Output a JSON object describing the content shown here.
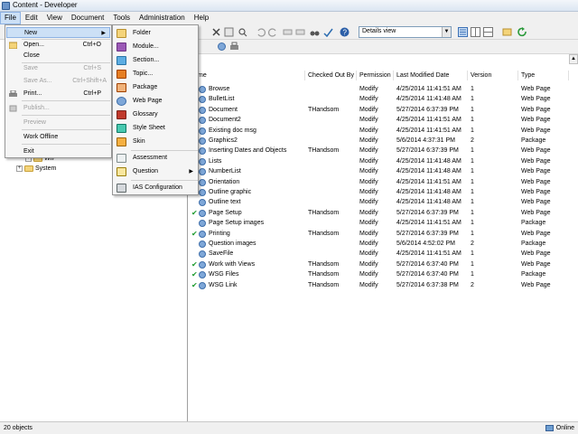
{
  "window": {
    "title": "Content - Developer"
  },
  "menubar": [
    "File",
    "Edit",
    "View",
    "Document",
    "Tools",
    "Administration",
    "Help"
  ],
  "view_select": {
    "value": "Details view"
  },
  "file_menu": {
    "new": "New",
    "open": "Open...",
    "open_shortcut": "Ctrl+O",
    "close": "Close",
    "save": "Save",
    "save_shortcut": "Ctrl+S",
    "save_as": "Save As...",
    "save_as_shortcut": "Ctrl+Shift+A",
    "print": "Print...",
    "print_shortcut": "Ctrl+P",
    "publish": "Publish...",
    "preview": "Preview",
    "work_offline": "Work Offline",
    "exit": "Exit"
  },
  "new_submenu": [
    "Folder",
    "Module...",
    "Section...",
    "Topic...",
    "Package",
    "Web Page",
    "Glossary",
    "Style Sheet",
    "Skin",
    "Assessment",
    "Question",
    "IAS Configuration"
  ],
  "tree": {
    "wip": "WIP",
    "system": "System"
  },
  "columns": {
    "name": "me",
    "checked_out_by": "Checked Out By",
    "permission": "Permission",
    "last_modified": "Last Modified Date",
    "version": "Version",
    "type": "Type"
  },
  "rows": [
    {
      "name": "Browse",
      "checked": "",
      "perm": "Modify",
      "date": "4/25/2014 11:41:51 AM",
      "ver": "1",
      "type": "Web Page",
      "check": false
    },
    {
      "name": "BulletList",
      "checked": "",
      "perm": "Modify",
      "date": "4/25/2014 11:41:48 AM",
      "ver": "1",
      "type": "Web Page",
      "check": false
    },
    {
      "name": "Document",
      "checked": "THandsom",
      "perm": "Modify",
      "date": "5/27/2014 6:37:39 PM",
      "ver": "1",
      "type": "Web Page",
      "check": false
    },
    {
      "name": "Document2",
      "checked": "",
      "perm": "Modify",
      "date": "4/25/2014 11:41:51 AM",
      "ver": "1",
      "type": "Web Page",
      "check": false
    },
    {
      "name": "Existing doc msg",
      "checked": "",
      "perm": "Modify",
      "date": "4/25/2014 11:41:51 AM",
      "ver": "1",
      "type": "Web Page",
      "check": false
    },
    {
      "name": "Graphics2",
      "checked": "",
      "perm": "Modify",
      "date": "5/6/2014 4:37:31 PM",
      "ver": "2",
      "type": "Package",
      "check": false
    },
    {
      "name": "Inserting Dates and Objects",
      "checked": "THandsom",
      "perm": "Modify",
      "date": "5/27/2014 6:37:39 PM",
      "ver": "1",
      "type": "Web Page",
      "check": false
    },
    {
      "name": "Lists",
      "checked": "",
      "perm": "Modify",
      "date": "4/25/2014 11:41:48 AM",
      "ver": "1",
      "type": "Web Page",
      "check": false
    },
    {
      "name": "NumberList",
      "checked": "",
      "perm": "Modify",
      "date": "4/25/2014 11:41:48 AM",
      "ver": "1",
      "type": "Web Page",
      "check": false
    },
    {
      "name": "Orientation",
      "checked": "",
      "perm": "Modify",
      "date": "4/25/2014 11:41:51 AM",
      "ver": "1",
      "type": "Web Page",
      "check": false
    },
    {
      "name": "Outline graphic",
      "checked": "",
      "perm": "Modify",
      "date": "4/25/2014 11:41:48 AM",
      "ver": "1",
      "type": "Web Page",
      "check": false
    },
    {
      "name": "Outline text",
      "checked": "",
      "perm": "Modify",
      "date": "4/25/2014 11:41:48 AM",
      "ver": "1",
      "type": "Web Page",
      "check": false
    },
    {
      "name": "Page Setup",
      "checked": "THandsom",
      "perm": "Modify",
      "date": "5/27/2014 6:37:39 PM",
      "ver": "1",
      "type": "Web Page",
      "check": true
    },
    {
      "name": "Page Setup images",
      "checked": "",
      "perm": "Modify",
      "date": "4/25/2014 11:41:51 AM",
      "ver": "1",
      "type": "Package",
      "check": false
    },
    {
      "name": "Printing",
      "checked": "THandsom",
      "perm": "Modify",
      "date": "5/27/2014 6:37:39 PM",
      "ver": "1",
      "type": "Web Page",
      "check": true
    },
    {
      "name": "Question images",
      "checked": "",
      "perm": "Modify",
      "date": "5/6/2014 4:52:02 PM",
      "ver": "2",
      "type": "Package",
      "check": false
    },
    {
      "name": "SaveFile",
      "checked": "",
      "perm": "Modify",
      "date": "4/25/2014 11:41:51 AM",
      "ver": "1",
      "type": "Web Page",
      "check": false
    },
    {
      "name": "Work with Views",
      "checked": "THandsom",
      "perm": "Modify",
      "date": "5/27/2014 6:37:40 PM",
      "ver": "1",
      "type": "Web Page",
      "check": true
    },
    {
      "name": "WSG Files",
      "checked": "THandsom",
      "perm": "Modify",
      "date": "5/27/2014 6:37:40 PM",
      "ver": "1",
      "type": "Package",
      "check": true
    },
    {
      "name": "WSG Link",
      "checked": "THandsom",
      "perm": "Modify",
      "date": "5/27/2014 6:37:38 PM",
      "ver": "2",
      "type": "Web Page",
      "check": true
    }
  ],
  "status": {
    "count": "20 objects",
    "mode": "Online"
  }
}
